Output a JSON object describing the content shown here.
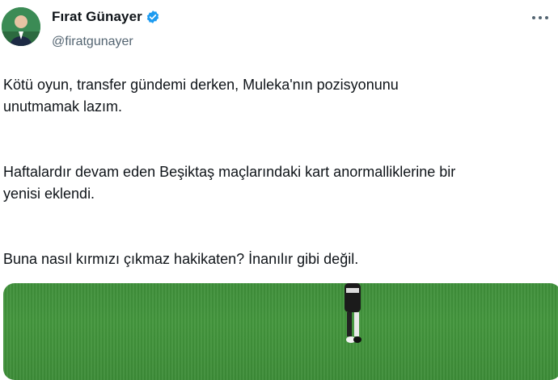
{
  "author": {
    "display_name": "Fırat Günayer",
    "handle": "@firatgunayer",
    "avatar_icon": "profile-avatar",
    "verified_icon": "verified-badge-icon",
    "verified_color": "#1d9bf0"
  },
  "tweet": {
    "paragraphs": [
      "Kötü oyun, transfer gündemi derken, Muleka'nın pozisyonunu\nunutmamak lazım.",
      "Haftalardır devam eden Beşiktaş maçlarındaki kart anormalliklerine bir\nyenisi eklendi.",
      "Buna nasıl kırmızı çıkmaz hakikaten? İnanılır gibi değil."
    ]
  },
  "media": {
    "type": "photo",
    "pitch_color": "#3f903b"
  },
  "menu": {
    "icon": "more-options-icon"
  }
}
